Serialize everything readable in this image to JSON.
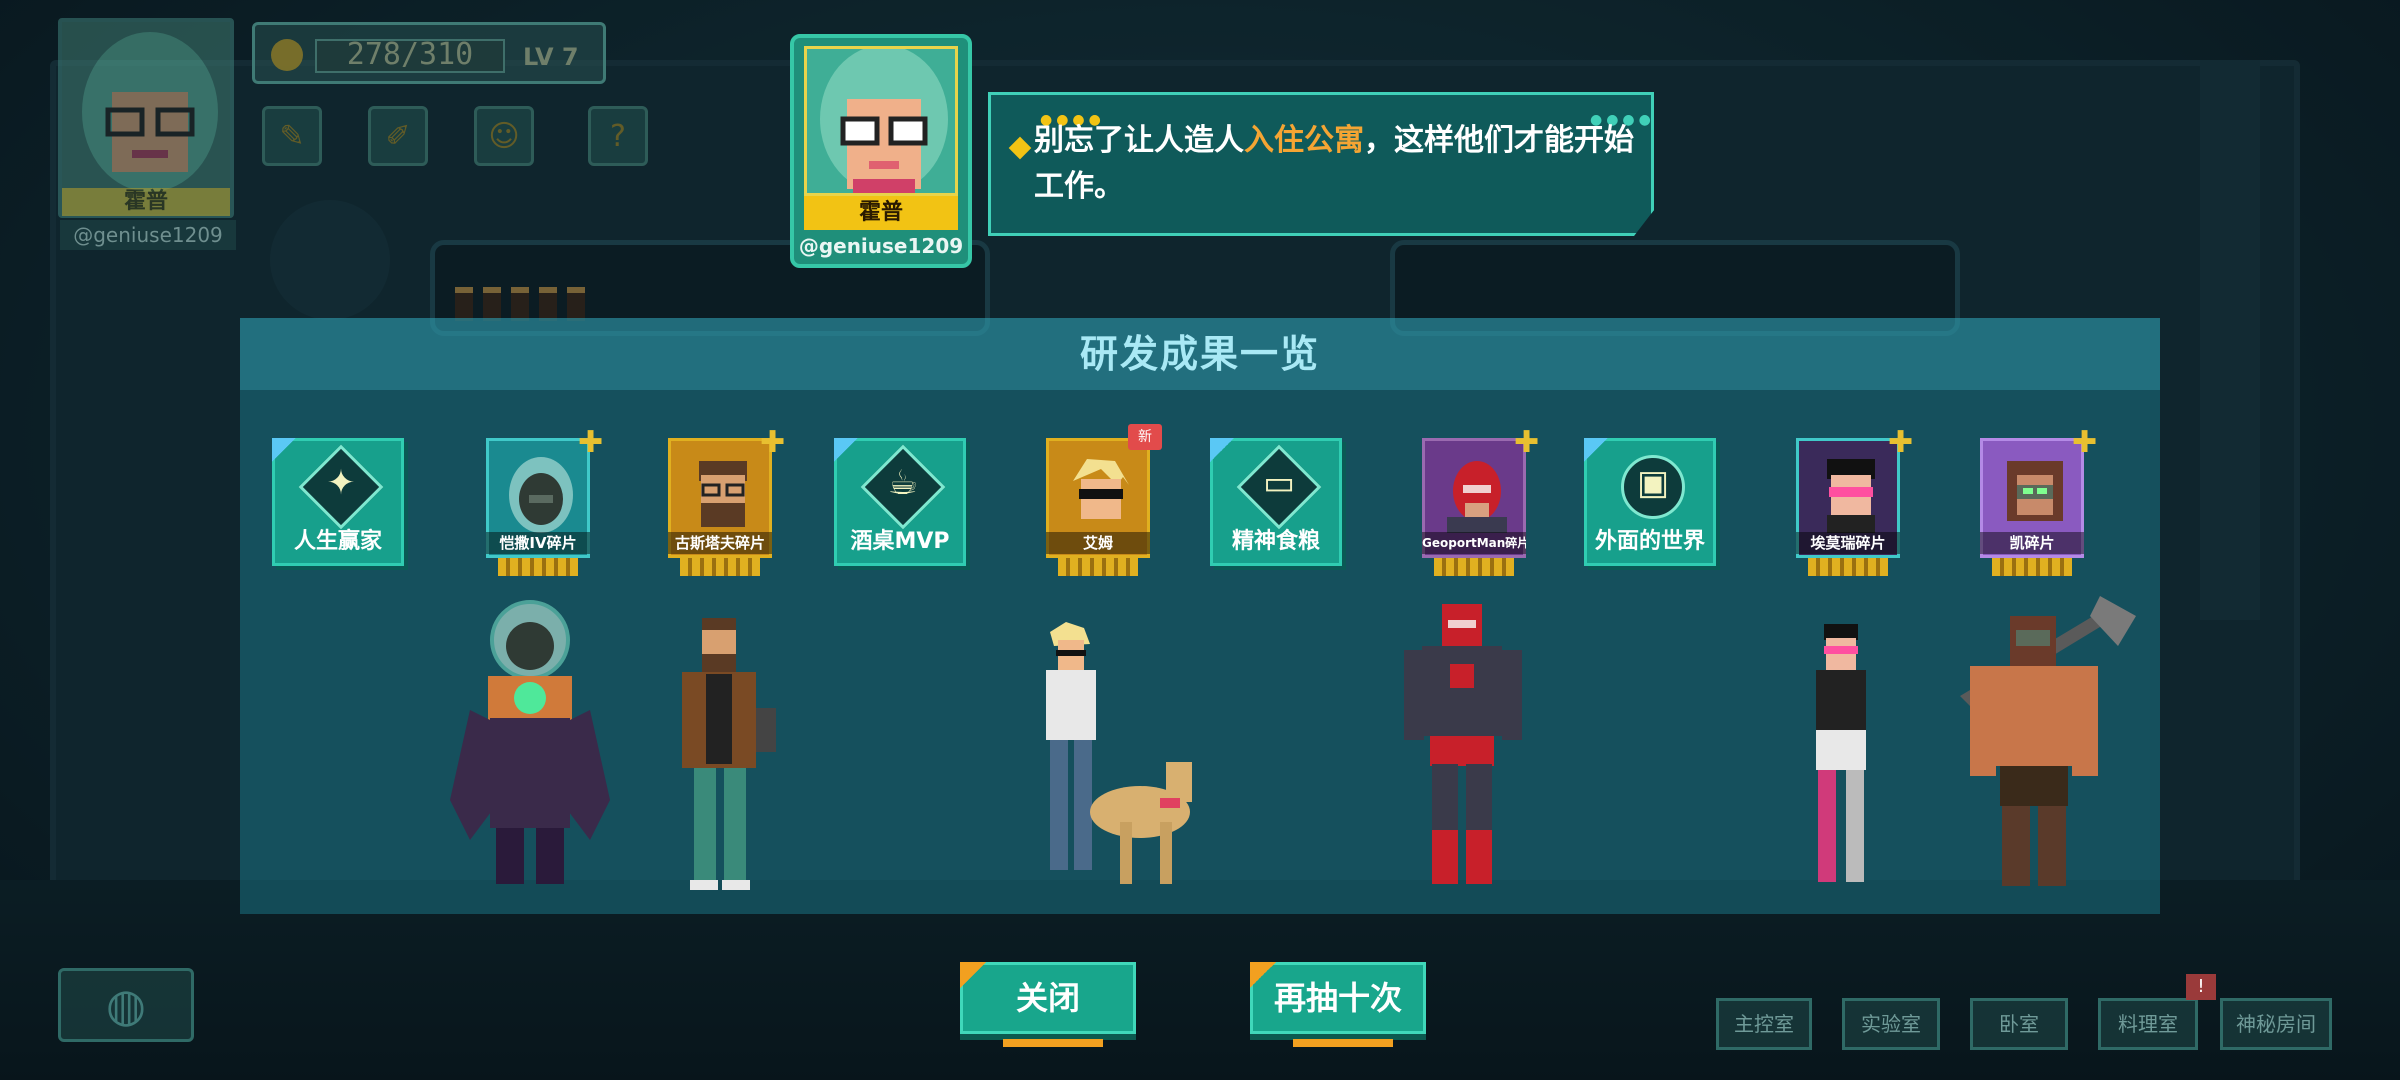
{
  "hud": {
    "player_name": "霍普",
    "handle": "@geniuse1209",
    "exp": "278/310",
    "level": "LV 7",
    "buttons": [
      "note-icon",
      "brush-icon",
      "smile-icon",
      "question-icon"
    ]
  },
  "npc": {
    "name": "霍普",
    "handle": "@geniuse1209",
    "dialog_part1": "别忘了让人造人",
    "dialog_highlight": "入住公寓",
    "dialog_part2": "，这样他们才能开始工作。",
    "highlight_color": "#f5a533"
  },
  "panel": {
    "title": "研发成果一览",
    "cards": [
      {
        "type": "item",
        "label": "人生赢家",
        "icon": "wings-icon"
      },
      {
        "type": "character",
        "label": "恺撒IV碎片",
        "tier": "gold",
        "plus": true
      },
      {
        "type": "character",
        "label": "古斯塔夫碎片",
        "tier": "gold",
        "plus": true
      },
      {
        "type": "item",
        "label": "酒桌MVP",
        "icon": "beer-mug-icon"
      },
      {
        "type": "character",
        "label": "艾姆",
        "tier": "gold",
        "badge": "新"
      },
      {
        "type": "item",
        "label": "精神食粮",
        "icon": "book-icon"
      },
      {
        "type": "character",
        "label": "GeoportMan碎片",
        "tier": "gold",
        "plus": true
      },
      {
        "type": "item",
        "label": "外面的世界",
        "icon": "luggage-icon"
      },
      {
        "type": "character",
        "label": "埃莫瑞碎片",
        "tier": "gold",
        "plus": true
      },
      {
        "type": "character",
        "label": "凯碎片",
        "tier": "gold",
        "plus": true
      }
    ]
  },
  "buttons": {
    "close": "关闭",
    "draw_ten": "再抽十次"
  },
  "rooms": [
    "主控室",
    "实验室",
    "卧室",
    "料理室",
    "神秘房间"
  ],
  "room_badge": "!",
  "colors": {
    "accent_teal": "#18a68c",
    "accent_gold": "#f2c314",
    "panel": "#1e8ca0"
  }
}
